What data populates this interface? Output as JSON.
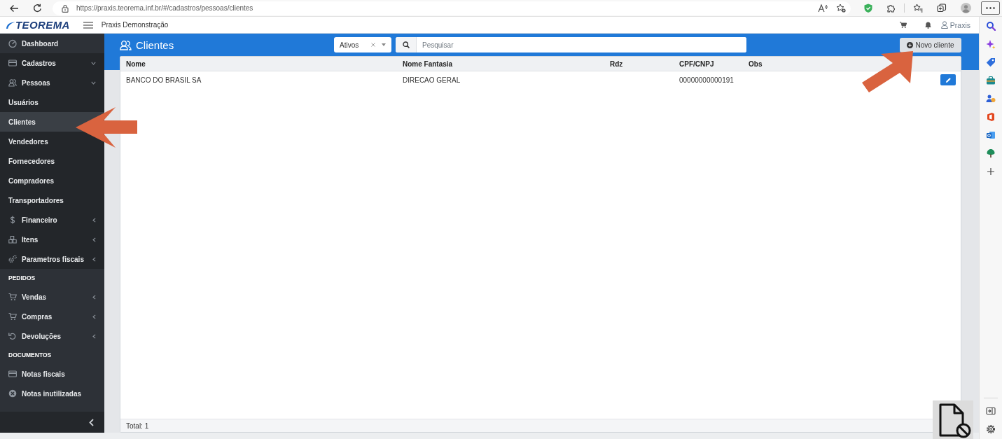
{
  "browser": {
    "url": "https://praxis.teorema.inf.br/#/cadastros/pessoas/clientes"
  },
  "app_header": {
    "logo": "TEOREMA",
    "company": "Praxis Demonstração",
    "user": "Praxis"
  },
  "sidebar": {
    "items": [
      {
        "kind": "link",
        "label": "Dashboard",
        "selected": false
      },
      {
        "kind": "group",
        "label": "Cadastros",
        "selected": false,
        "expanded": true,
        "children": [
          {
            "kind": "group",
            "label": "Pessoas",
            "selected": false,
            "expanded": true,
            "children": [
              {
                "kind": "link",
                "label": "Usuários",
                "selected": false
              },
              {
                "kind": "link",
                "label": "Clientes",
                "selected": true
              },
              {
                "kind": "link",
                "label": "Vendedores",
                "selected": false
              },
              {
                "kind": "link",
                "label": "Fornecedores",
                "selected": false
              },
              {
                "kind": "link",
                "label": "Compradores",
                "selected": false
              },
              {
                "kind": "link",
                "label": "Transportadores",
                "selected": false
              }
            ]
          },
          {
            "kind": "group",
            "label": "Financeiro",
            "selected": false,
            "expanded": false
          },
          {
            "kind": "group",
            "label": "Itens",
            "selected": false,
            "expanded": false
          },
          {
            "kind": "group",
            "label": "Parametros fiscais",
            "selected": false,
            "expanded": false
          }
        ]
      },
      {
        "kind": "section",
        "label": "PEDIDOS"
      },
      {
        "kind": "group",
        "label": "Vendas",
        "selected": false,
        "expanded": false
      },
      {
        "kind": "group",
        "label": "Compras",
        "selected": false,
        "expanded": false
      },
      {
        "kind": "group",
        "label": "Devoluções",
        "selected": false,
        "expanded": false
      },
      {
        "kind": "section",
        "label": "DOCUMENTOS"
      },
      {
        "kind": "link",
        "label": "Notas fiscais",
        "selected": false
      },
      {
        "kind": "link",
        "label": "Notas inutilizadas",
        "selected": false
      }
    ]
  },
  "page": {
    "title": "Clientes",
    "status_filter": {
      "value": "Ativos"
    },
    "search": {
      "placeholder": "Pesquisar"
    },
    "new_button": "Novo cliente"
  },
  "table": {
    "columns": [
      "Nome",
      "Nome Fantasia",
      "Rdz",
      "CPF/CNPJ",
      "Obs"
    ],
    "rows": [
      {
        "nome": "BANCO DO BRASIL SA",
        "nome_fantasia": "DIRECAO GERAL",
        "cpf_cnpj": "00000000000191"
      }
    ],
    "footer": "Total: 1"
  },
  "annotations": [
    {
      "kind": "arrow_left"
    },
    {
      "kind": "arrow_up_right"
    }
  ]
}
